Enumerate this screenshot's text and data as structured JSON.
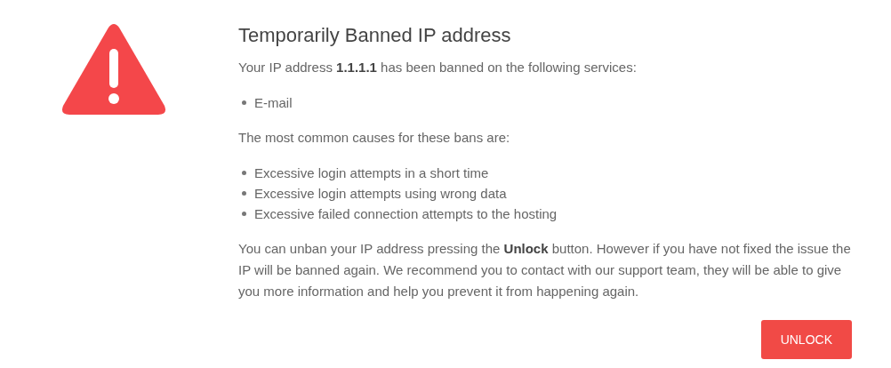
{
  "title": "Temporarily Banned IP address",
  "intro": "Your IP address **1.1.1.1** has been banned on the following services:",
  "services": [
    "E-mail"
  ],
  "causes_intro": "The most common causes for these bans are:",
  "causes": [
    "Excessive login attempts in a short time",
    "Excessive login attempts using wrong data",
    "Excessive failed connection attempts to the hosting"
  ],
  "advice": "You can unban your IP address pressing the **Unlock** button. However if you have not fixed the issue the IP will be banned again. We recommend you to contact with our support team, they will be able to give you more information and help you prevent it from happening again.",
  "button": "UNLOCK"
}
